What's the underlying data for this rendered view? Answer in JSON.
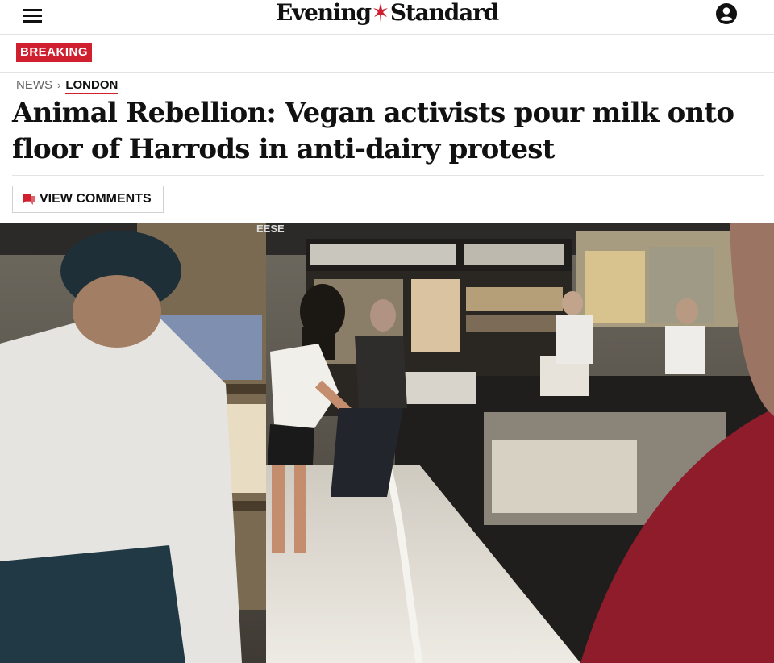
{
  "header": {
    "logo_text_left": "Evening",
    "logo_text_right": "Standard",
    "menu_icon": "hamburger-menu-icon",
    "account_icon": "account-circle-icon"
  },
  "breaking": {
    "label": "BREAKING"
  },
  "breadcrumb": {
    "section": "NEWS",
    "separator": "›",
    "subsection": "LONDON"
  },
  "article": {
    "headline": "Animal Rebellion: Vegan activists pour milk onto floor of Harrods in anti-dairy protest",
    "comments_button": "VIEW COMMENTS",
    "comments_icon": "comment-bubble-icon"
  },
  "photo": {
    "sign_text": "EESE"
  },
  "colors": {
    "accent": "#d01f2e",
    "text": "#111111",
    "divider": "#e3e3e3"
  }
}
